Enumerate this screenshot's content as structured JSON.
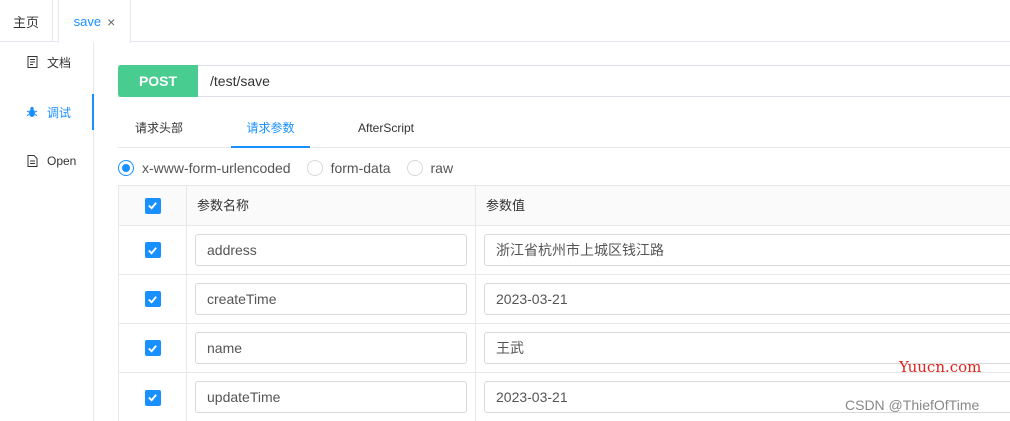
{
  "top_tabs": {
    "home": "主页",
    "save": "save",
    "close_glyph": "×"
  },
  "sidebar": {
    "items": [
      {
        "label": "文档",
        "icon": "document-icon"
      },
      {
        "label": "调试",
        "icon": "bug-icon",
        "active": true
      },
      {
        "label": "Open",
        "icon": "file-icon"
      }
    ]
  },
  "request": {
    "method": "POST",
    "method_color": "#49cc90",
    "url": "/test/save"
  },
  "param_tabs": [
    {
      "label": "请求头部"
    },
    {
      "label": "请求参数",
      "active": true
    },
    {
      "label": "AfterScript"
    }
  ],
  "body_types": [
    {
      "label": "x-www-form-urlencoded",
      "selected": true
    },
    {
      "label": "form-data",
      "selected": false
    },
    {
      "label": "raw",
      "selected": false
    }
  ],
  "table": {
    "headers": {
      "name": "参数名称",
      "value": "参数值"
    },
    "rows": [
      {
        "checked": true,
        "name": "address",
        "value": "浙江省杭州市上城区钱江路"
      },
      {
        "checked": true,
        "name": "createTime",
        "value": "2023-03-21"
      },
      {
        "checked": true,
        "name": "name",
        "value": "王武"
      },
      {
        "checked": true,
        "name": "updateTime",
        "value": "2023-03-21"
      }
    ]
  },
  "watermarks": {
    "site": "Yuucn.com",
    "author": "CSDN @ThiefOfTime"
  },
  "colors": {
    "accent": "#1890ff",
    "post": "#49cc90",
    "watermark_red": "#e0241d"
  }
}
